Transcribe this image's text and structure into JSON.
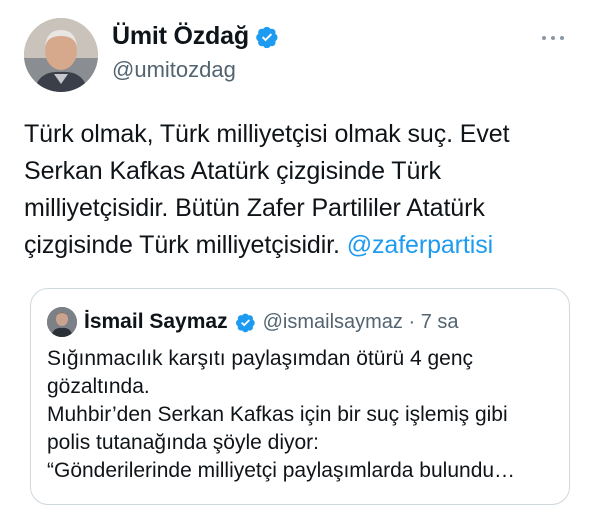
{
  "author": {
    "display_name": "Ümit Özdağ",
    "handle": "@umitozdag",
    "verified": true,
    "avatar_icon": "user-avatar"
  },
  "menu_icon": "more-horizontal-icon",
  "tweet": {
    "text": "Türk olmak, Türk milliyetçisi olmak suç. Evet\nSerkan Kafkas Atatürk çizgisinde Türk\nmilliyetçisidir. Bütün Zafer Partililer Atatürk\nçizgisinde Türk milliyetçisidir. ",
    "mention": "@zaferpartisi"
  },
  "quote": {
    "display_name": "İsmail Saymaz",
    "handle_time": "@ismailsaymaz · 7 sa",
    "verified": true,
    "lines": [
      "Sığınmacılık karşıtı paylaşımdan ötürü 4 genç",
      "gözaltında.",
      "Muhbir’den Serkan Kafkas için bir suç işlemiş gibi",
      "polis tutanağında şöyle diyor:",
      "“Gönderilerinde milliyetçi paylaşımlarda bulundu…"
    ]
  },
  "colors": {
    "verified": "#1d9bf0",
    "link": "#1d9bf0",
    "secondary_text": "#536471",
    "border": "#cfd9de"
  }
}
